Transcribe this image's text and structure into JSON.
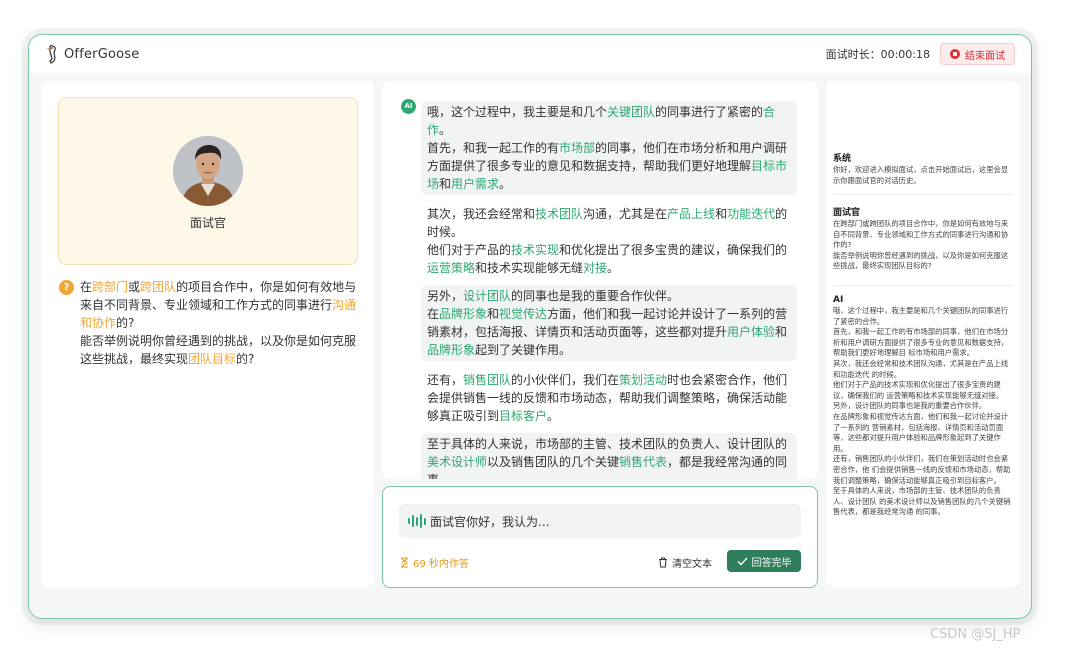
{
  "header": {
    "app_name": "OfferGoose",
    "timer_label": "面试时长：00:00:18",
    "end_button": "结束面试"
  },
  "interviewer": {
    "name": "面试官"
  },
  "question": {
    "icon": "question-icon",
    "segments": [
      {
        "t": "在",
        "c": ""
      },
      {
        "t": "跨部门",
        "c": "o"
      },
      {
        "t": "或",
        "c": ""
      },
      {
        "t": "跨团队",
        "c": "o"
      },
      {
        "t": "的项目合作中，你是如何有效地与来自不同背景、专业领域和工作方式的同事进行",
        "c": ""
      },
      {
        "t": "沟通和协作",
        "c": "o"
      },
      {
        "t": "的?",
        "c": ""
      },
      {
        "t": "\n能否举例说明你曾经遇到的挑战，以及你是如何克服这些挑战，最终实现",
        "c": ""
      },
      {
        "t": "团队目标",
        "c": "o"
      },
      {
        "t": "的?",
        "c": ""
      }
    ]
  },
  "answer": {
    "ai_badge": "AI",
    "paragraphs": [
      {
        "shaded": true,
        "segments": [
          {
            "t": "哦，这个过程中，我主要是和几个",
            "c": ""
          },
          {
            "t": "关键团队",
            "c": "g"
          },
          {
            "t": "的同事进行了紧密的",
            "c": ""
          },
          {
            "t": "合作",
            "c": "g"
          },
          {
            "t": "。\n首先，和我一起工作的有",
            "c": ""
          },
          {
            "t": "市场部",
            "c": "g"
          },
          {
            "t": "的同事，他们在市场分析和用户调研方面提供了很多专业的意见和数据支持，帮助我们更好地理解",
            "c": ""
          },
          {
            "t": "目标市场",
            "c": "g"
          },
          {
            "t": "和",
            "c": ""
          },
          {
            "t": "用户需求",
            "c": "g"
          },
          {
            "t": "。",
            "c": ""
          }
        ]
      },
      {
        "shaded": false,
        "segments": [
          {
            "t": "其次，我还会经常和",
            "c": ""
          },
          {
            "t": "技术团队",
            "c": "g"
          },
          {
            "t": "沟通，尤其是在",
            "c": ""
          },
          {
            "t": "产品上线",
            "c": "g"
          },
          {
            "t": "和",
            "c": ""
          },
          {
            "t": "功能迭代",
            "c": "g"
          },
          {
            "t": "的时候。\n他们对于产品的",
            "c": ""
          },
          {
            "t": "技术实现",
            "c": "g"
          },
          {
            "t": "和优化提出了很多宝贵的建议，确保我们的",
            "c": ""
          },
          {
            "t": "运营策略",
            "c": "g"
          },
          {
            "t": "和技术实现能够无缝",
            "c": ""
          },
          {
            "t": "对接",
            "c": "g"
          },
          {
            "t": "。",
            "c": ""
          }
        ]
      },
      {
        "shaded": true,
        "segments": [
          {
            "t": "另外，",
            "c": ""
          },
          {
            "t": "设计团队",
            "c": "g"
          },
          {
            "t": "的同事也是我的重要合作伙伴。\n在",
            "c": ""
          },
          {
            "t": "品牌形象",
            "c": "g"
          },
          {
            "t": "和",
            "c": ""
          },
          {
            "t": "视觉传达",
            "c": "g"
          },
          {
            "t": "方面，他们和我一起讨论并设计了一系列的营销素材，包括海报、详情页和活动页面等，这些都对提升",
            "c": ""
          },
          {
            "t": "用户体验",
            "c": "g"
          },
          {
            "t": "和",
            "c": ""
          },
          {
            "t": "品牌形象",
            "c": "g"
          },
          {
            "t": "起到了关键作用。",
            "c": ""
          }
        ]
      },
      {
        "shaded": false,
        "segments": [
          {
            "t": "还有，",
            "c": ""
          },
          {
            "t": "销售团队",
            "c": "g"
          },
          {
            "t": "的小伙伴们，我们在",
            "c": ""
          },
          {
            "t": "策划活动",
            "c": "g"
          },
          {
            "t": "时也会紧密合作，他们会提供销售一线的反馈和市场动态，帮助我们调整策略，确保活动能够真正吸引到",
            "c": ""
          },
          {
            "t": "目标客户",
            "c": "g"
          },
          {
            "t": "。",
            "c": ""
          }
        ]
      },
      {
        "shaded": true,
        "segments": [
          {
            "t": "至于具体的人来说，市场部的主管、技术团队的负责人、设计团队的",
            "c": ""
          },
          {
            "t": "美术设计师",
            "c": "g"
          },
          {
            "t": "以及销售团队的几个关键",
            "c": ""
          },
          {
            "t": "销售代表",
            "c": "g"
          },
          {
            "t": "，都是我经常沟通的同事。",
            "c": ""
          }
        ]
      }
    ]
  },
  "answer_input": {
    "text": "面试官你好，我认为...",
    "time_left": "69 秒内作答",
    "clear_label": "清空文本",
    "done_label": "回答完毕"
  },
  "history": [
    {
      "title": "系统",
      "body": "你好，欢迎进入模拟面试，点击开始面试后，这里会显示你跟面试官的对话历史。"
    },
    {
      "title": "面试官",
      "body": "在跨部门或跨团队的项目合作中，你是如何有效地与来自不同背景、专业领域和工作方式的同事进行沟通和协作的?\n能否举例说明你曾经遇到的挑战，以及你是如何克服这些挑战，最终实现团队目标的?"
    },
    {
      "title": "AI",
      "body": "哦，这个过程中，我主要是和几个关键团队的同事进行了紧密的合作。\n首先，和我一起工作的有市场部的同事，他们在市场分析和用户调研方面提供了很多专业的意见和数据支持，帮助我们更好地理解目 标市场和用户需求。\n其次，我还会经常和技术团队沟通，尤其是在产品上线和功能迭代 的时候。\n他们对于产品的技术实现和优化提出了很多宝贵的建议，确保我们的 运营策略和技术实现能够无缝对接。\n另外，设计团队的同事也是我的重要合作伙伴。\n在品牌形象和视觉传达方面，他们和我一起讨论并设计了一系列的 营销素材，包括海报、详情页和活动页面等，这些都对提升用户体验和品牌形象起到了关键作用。\n还有，销售团队的小伙伴们，我们在策划活动时也会紧密合作，他 们会提供销售一线的反馈和市场动态，帮助我们调整策略，确保活动能够真正吸引到目标客户。\n至于具体的人来说，市场部的主管、技术团队的负责人、设计团队 的美术设计师以及销售团队的几个关键销售代表，都是我经常沟通 的同事。"
    }
  ],
  "watermark": "CSDN @SJ_HP",
  "colors": {
    "accent_green": "#2ea872",
    "accent_orange": "#f0a630",
    "end_red": "#e03131"
  }
}
